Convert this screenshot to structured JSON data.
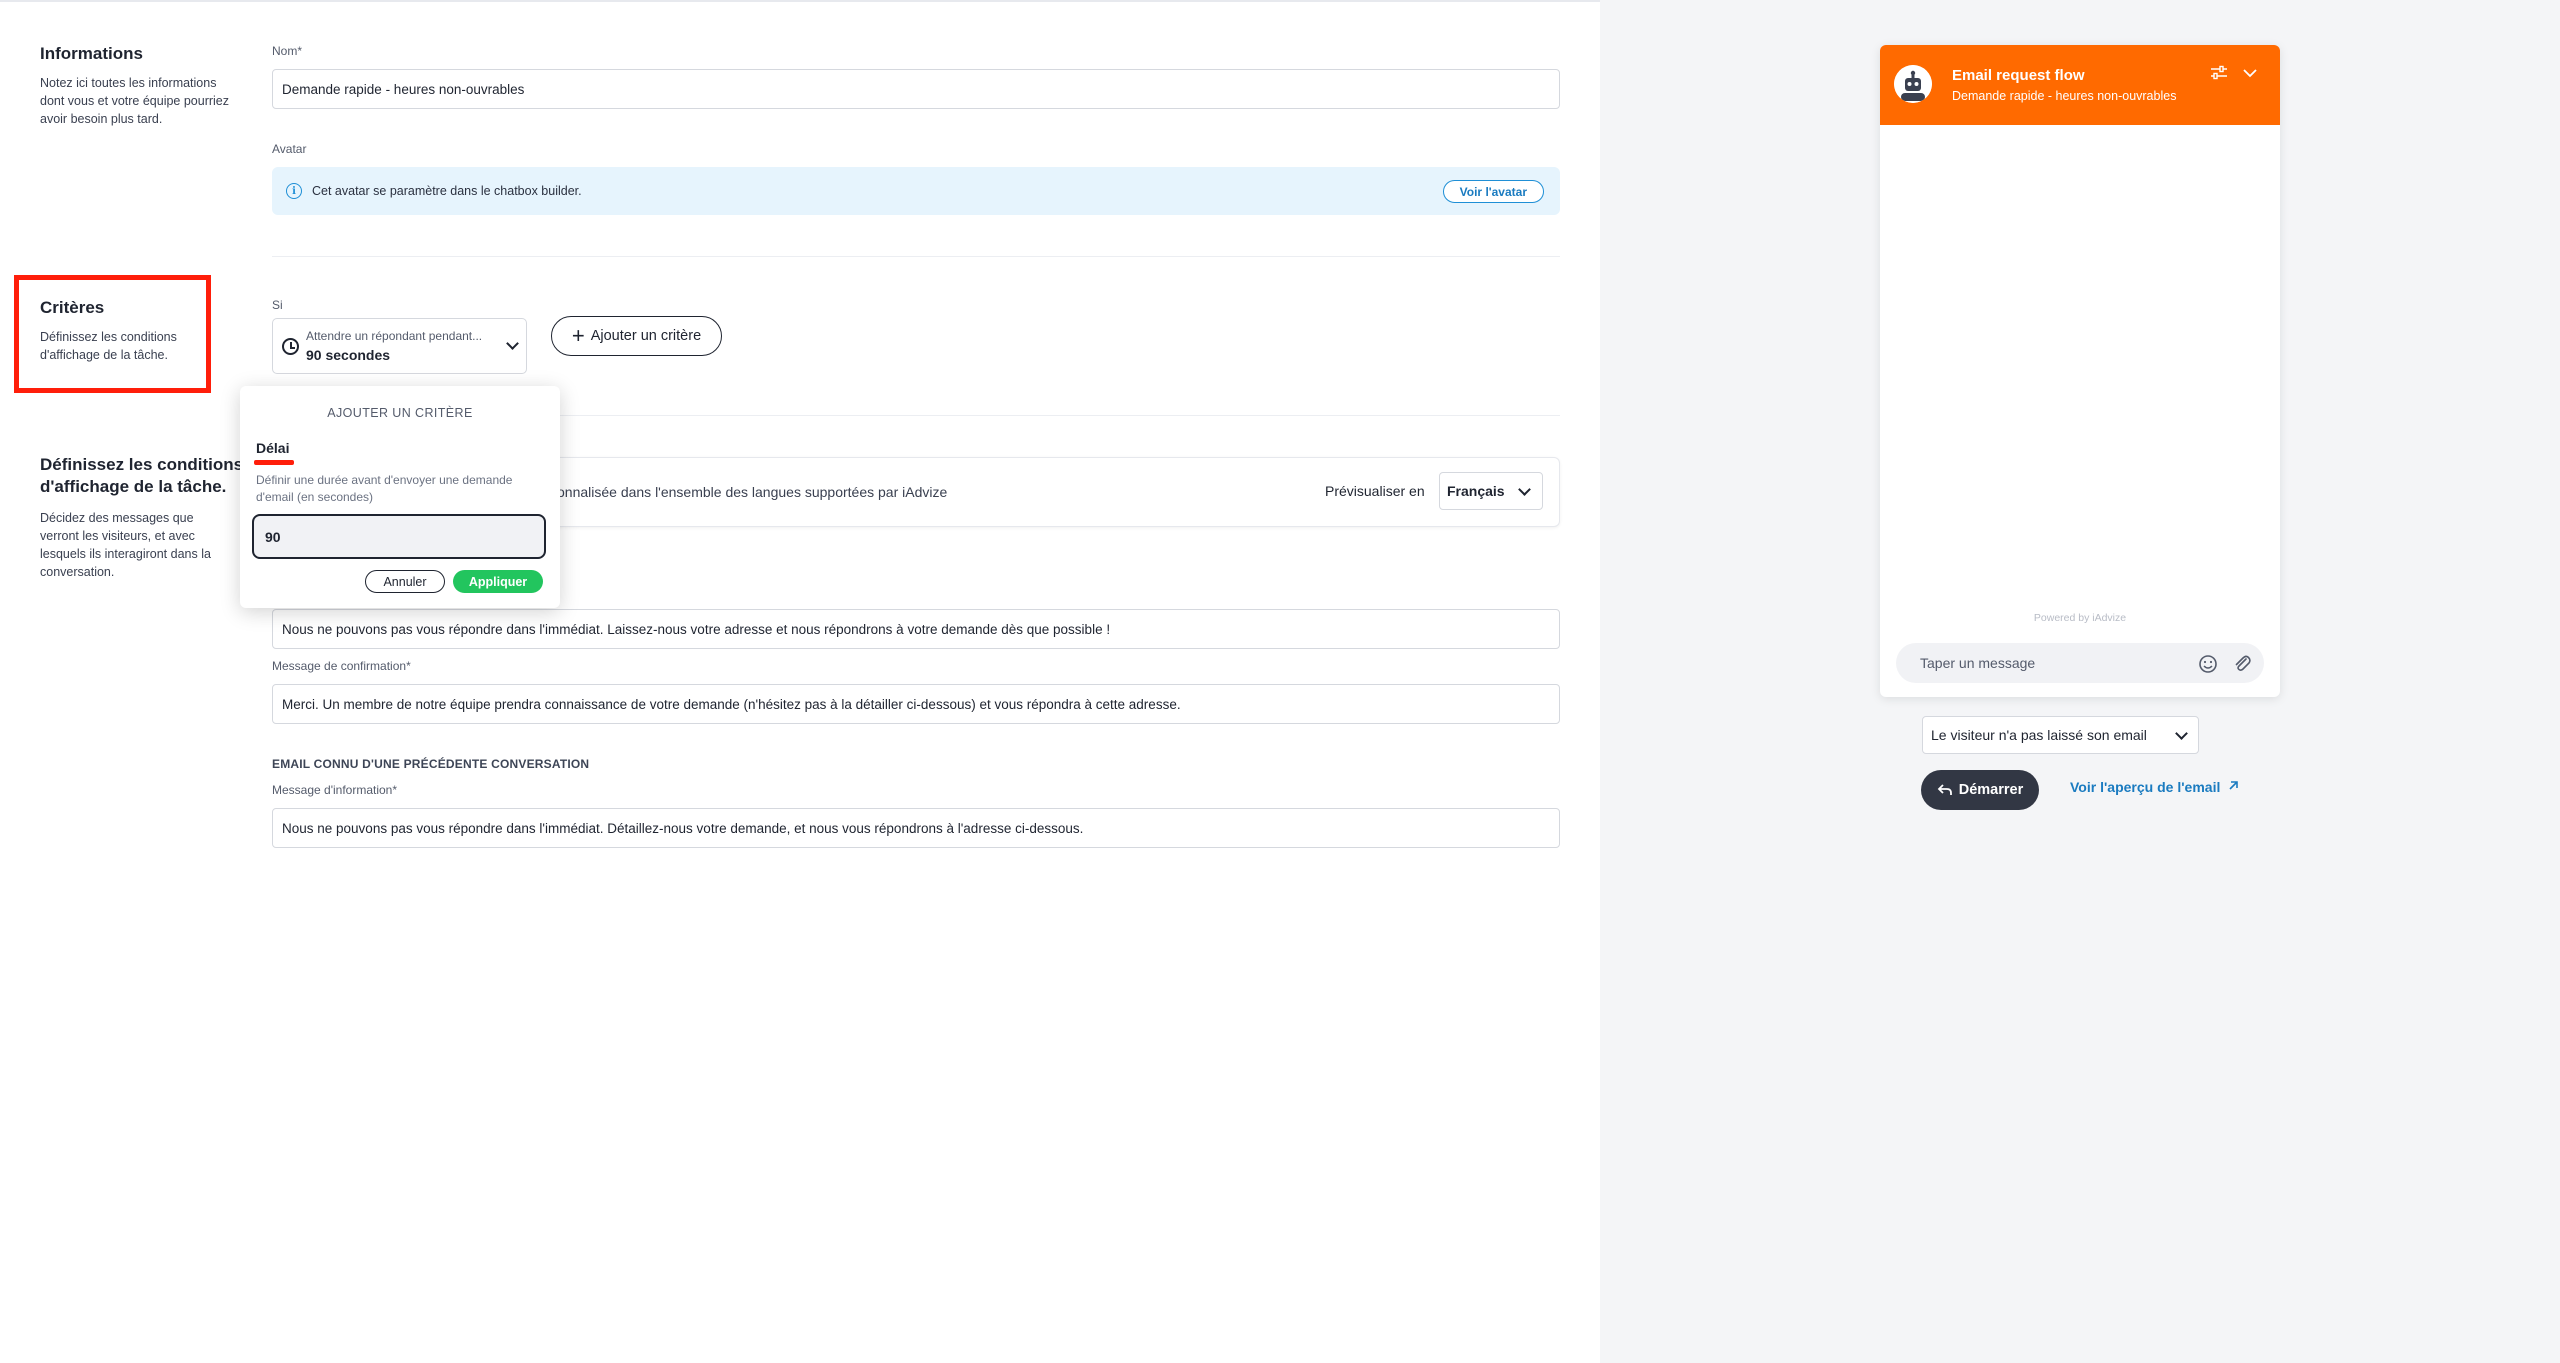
{
  "info": {
    "title": "Informations",
    "desc": [
      "Notez ici toutes les informations",
      "dont vous et votre équipe pourriez",
      "avoir besoin plus tard."
    ],
    "name_label": "Nom*",
    "name_value": "Demande rapide - heures non-ouvrables",
    "avatar_label": "Avatar",
    "avatar_banner": "Cet avatar se paramètre dans le chatbox builder.",
    "avatar_button": "Voir l'avatar"
  },
  "criteria": {
    "title": "Critères",
    "desc": [
      "Définissez les conditions",
      "d'affichage de la tâche."
    ],
    "if_label": "Si",
    "select_sub": "Attendre un répondant pendant...",
    "select_value": "90 secondes",
    "add_button": "Ajouter un critère"
  },
  "messages": {
    "title": [
      "Définissez les conditions",
      "d'affichage de la tâche."
    ],
    "desc": [
      "Décidez des messages que",
      "verront les visiteurs, et avec",
      "lesquels ils interagiront dans la",
      "conversation."
    ],
    "lang_text": "onnalisée dans l'ensemble des langues supportées par iAdvize",
    "preview_label": "Prévisualiser en",
    "preview_lang": "Français",
    "msg1": "Nous ne pouvons pas vous répondre dans l'immédiat. Laissez-nous votre adresse et nous répondrons à votre demande dès que possible !",
    "confirm_label": "Message de confirmation*",
    "confirm_value": "Merci. Un membre de notre équipe prendra connaissance de votre demande (n'hésitez pas à la détailler ci-dessous) et vous répondra à cette adresse.",
    "known_caption": "EMAIL CONNU D'UNE PRÉCÉDENTE CONVERSATION",
    "info_label": "Message d'information*",
    "info_value": "Nous ne pouvons pas vous répondre dans l'immédiat. Détaillez-nous votre demande, et nous vous répondrons à l'adresse ci-dessous."
  },
  "popup": {
    "title": "AJOUTER UN CRITÈRE",
    "tab": "Délai",
    "desc": "Définir une durée avant d'envoyer une demande d'email (en secondes)",
    "value": "90",
    "cancel": "Annuler",
    "apply": "Appliquer"
  },
  "preview": {
    "chat_title": "Email request flow",
    "chat_sub": "Demande rapide - heures non-ouvrables",
    "powered": "Powered by iAdvize",
    "input_placeholder": "Taper un message",
    "visitor_select": "Le visiteur n'a pas laissé son email",
    "start_button": "Démarrer",
    "email_link": "Voir l'aperçu de l'email"
  },
  "colors": {
    "accent_orange": "#ff6a00",
    "apply_green": "#22c55e",
    "link_blue": "#1a7bc0",
    "highlight_red": "#ff1e0a"
  },
  "icons": [
    "info-icon",
    "clock-icon",
    "chevron-down-icon",
    "plus-icon",
    "robot-icon",
    "settings-sliders-icon",
    "emoji-icon",
    "paperclip-icon",
    "reply-arrow-icon",
    "external-link-icon"
  ]
}
